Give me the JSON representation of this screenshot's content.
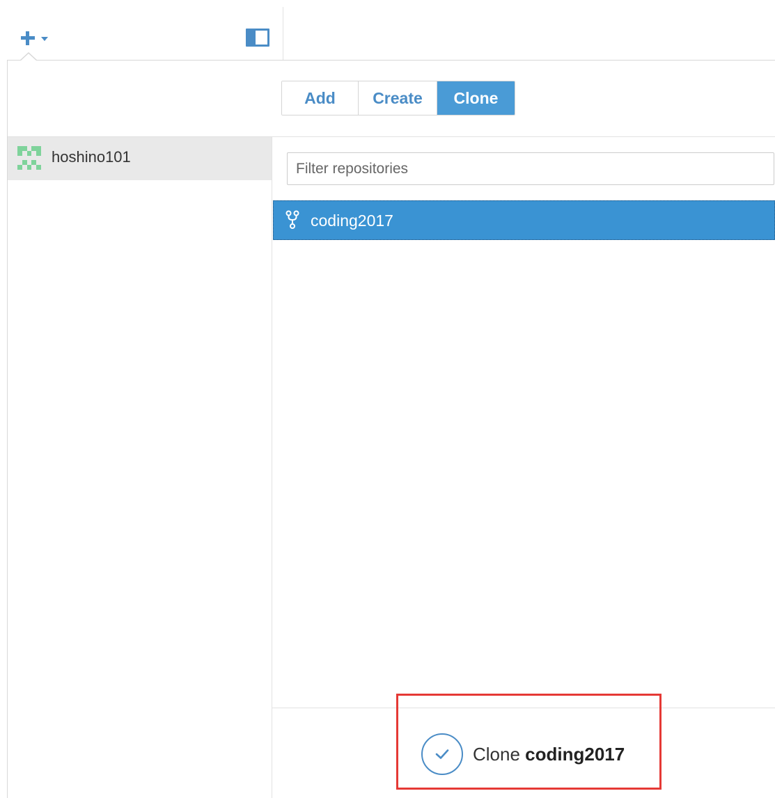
{
  "toolbar": {
    "add_menu_icon": "plus-icon",
    "caret_icon": "caret-down-icon",
    "sidebar_toggle_icon": "sidebar-toggle-icon"
  },
  "tabs": [
    {
      "label": "Add",
      "active": false
    },
    {
      "label": "Create",
      "active": false
    },
    {
      "label": "Clone",
      "active": true
    }
  ],
  "accounts": [
    {
      "name": "hoshino101",
      "selected": true
    }
  ],
  "filter": {
    "placeholder": "Filter repositories",
    "value": ""
  },
  "repositories": [
    {
      "name": "coding2017",
      "icon": "fork-icon",
      "selected": true
    }
  ],
  "footer": {
    "action_prefix": "Clone",
    "action_repo": "coding2017",
    "icon": "check-circle-icon"
  },
  "colors": {
    "accent": "#4a8cc6",
    "selection": "#3a93d3",
    "highlight": "#e53935"
  }
}
